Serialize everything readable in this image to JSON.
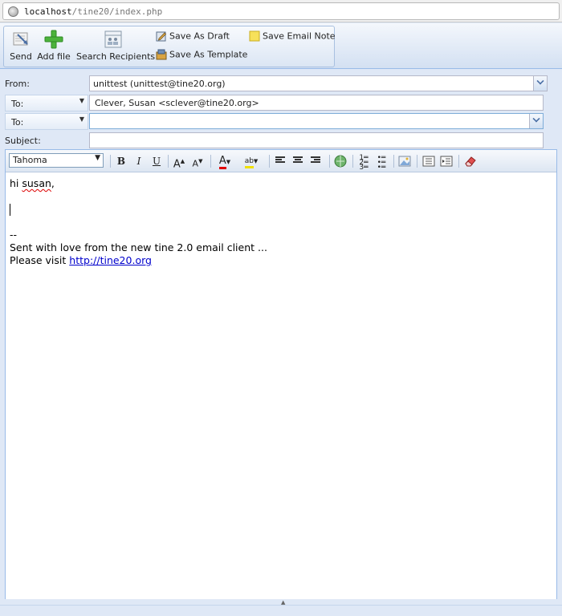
{
  "browser": {
    "url_host": "localhost",
    "url_path": "/tine20/index.php"
  },
  "toolbar": {
    "send_label": "Send",
    "add_file_label": "Add file",
    "search_recipients_label": "Search Recipients",
    "save_as_draft_label": "Save As Draft",
    "save_email_note_label": "Save Email Note",
    "save_as_template_label": "Save As Template"
  },
  "form": {
    "from_label": "From:",
    "from_value": "unittest (unittest@tine20.org)",
    "recipients": [
      {
        "type_label": "To:",
        "value": "Clever, Susan <sclever@tine20.org>"
      },
      {
        "type_label": "To:",
        "value": ""
      }
    ],
    "subject_label": "Subject:",
    "subject_value": ""
  },
  "editor": {
    "font_family": "Tahoma",
    "body_line1": "hi susan,",
    "signature_separator": "--",
    "signature_line1": "Sent with love from the new tine 2.0 email client ...",
    "signature_line2_prefix": "Please visit ",
    "signature_link": "http://tine20.org"
  }
}
